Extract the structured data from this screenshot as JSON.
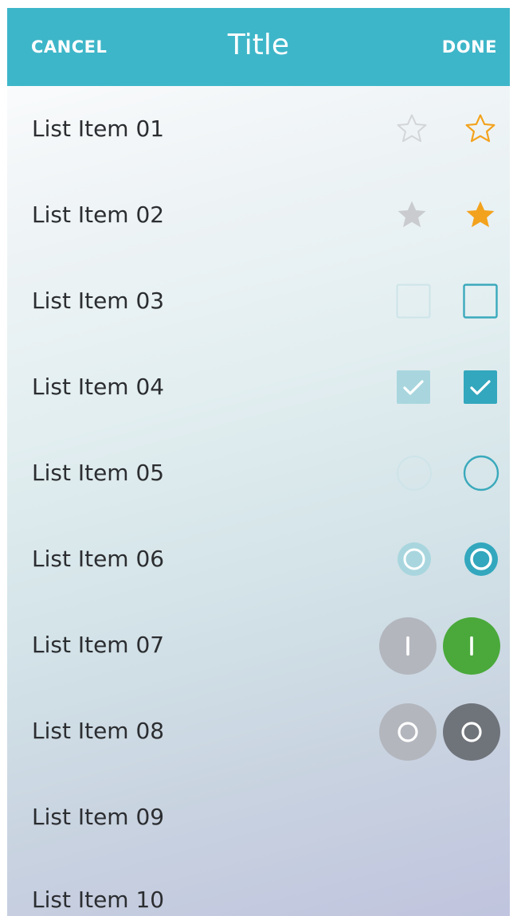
{
  "header": {
    "cancel_label": "CANCEL",
    "title": "Title",
    "done_label": "DONE",
    "background": "#3eb6c9"
  },
  "list": {
    "items": [
      {
        "label": "List Item 01",
        "controls": [
          "star-outline-icon (disabled)",
          "star-outline-icon (enabled)"
        ]
      },
      {
        "label": "List Item 02",
        "controls": [
          "star-filled-icon (disabled)",
          "star-filled-icon (enabled)"
        ]
      },
      {
        "label": "List Item 03",
        "controls": [
          "checkbox-unchecked (disabled)",
          "checkbox-unchecked (enabled)"
        ]
      },
      {
        "label": "List Item 04",
        "controls": [
          "checkbox-checked (disabled)",
          "checkbox-checked (enabled)"
        ]
      },
      {
        "label": "List Item 05",
        "controls": [
          "radio-unselected (disabled)",
          "radio-unselected (enabled)"
        ]
      },
      {
        "label": "List Item 06",
        "controls": [
          "radio-selected (disabled)",
          "radio-selected (enabled)"
        ]
      },
      {
        "label": "List Item 07",
        "controls": [
          "toggle-on (disabled)",
          "toggle-on (enabled)"
        ]
      },
      {
        "label": "List Item 08",
        "controls": [
          "toggle-off (disabled)",
          "toggle-off (enabled)"
        ]
      },
      {
        "label": "List Item 09",
        "controls": []
      },
      {
        "label": "List Item 10",
        "controls": []
      }
    ]
  },
  "colors": {
    "accent": "#3eb6c9",
    "star_active": "#f3a21d",
    "star_inactive": "#c9cbcf",
    "toggle_on": "#4aa93a",
    "toggle_off": "#6f737a",
    "toggle_disabled": "#b3b6bd",
    "text": "#2b2d30"
  }
}
